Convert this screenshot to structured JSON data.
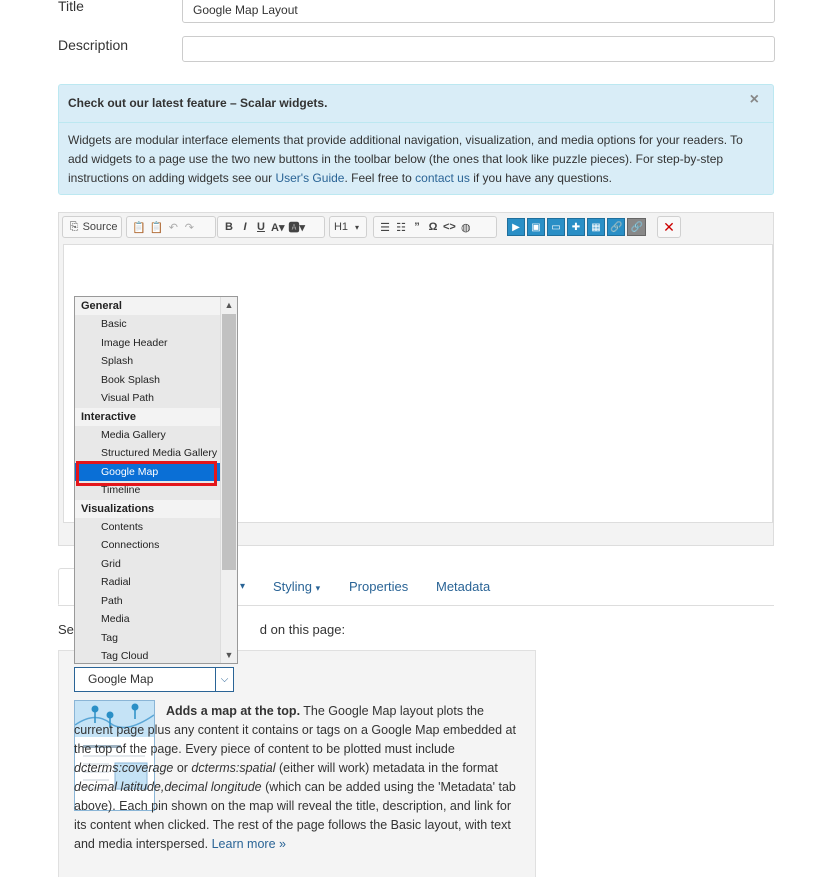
{
  "form": {
    "title_label": "Title",
    "title_value": "Google Map Layout",
    "description_label": "Description",
    "description_value": ""
  },
  "alert": {
    "heading": "Check out our latest feature – Scalar widgets.",
    "close": "×",
    "body_1": "Widgets are modular interface elements that provide additional navigation, visualization, and media options for your readers. To add widgets to a page use the two new buttons in the toolbar below (the ones that look like puzzle pieces). For step-by-step instructions on adding widgets see our ",
    "guide_link": "User's Guide",
    "body_2": ". Feel free to ",
    "contact_link": "contact us",
    "body_3": " if you have any questions."
  },
  "toolbar": {
    "source": "Source",
    "bold": "B",
    "italic": "I",
    "underline": "U",
    "heading": "H1",
    "quote": "”",
    "omega": "Ω",
    "code": "<>",
    "remove": "✕"
  },
  "dropdown": {
    "groups": [
      {
        "label": "General",
        "items": [
          "Basic",
          "Image Header",
          "Splash",
          "Book Splash",
          "Visual Path"
        ]
      },
      {
        "label": "Interactive",
        "items": [
          "Media Gallery",
          "Structured Media Gallery",
          "Google Map",
          "Timeline"
        ]
      },
      {
        "label": "Visualizations",
        "items": [
          "Contents",
          "Connections",
          "Grid",
          "Radial",
          "Path",
          "Media",
          "Tag",
          "Tag Cloud"
        ]
      }
    ],
    "selected": "Google Map"
  },
  "tabs": {
    "styling": "Styling",
    "properties": "Properties",
    "metadata": "Metadata"
  },
  "layout": {
    "select_prefix": "Sel",
    "select_suffix": "d on this page:",
    "selected_value": "Google Map",
    "desc_bold": "Adds a map at the top.",
    "desc_1": " The Google Map layout plots the current page plus any content it contains or tags on a Google Map embedded at the top of the page. Every piece of content to be plotted must include ",
    "desc_em1": "dcterms:coverage",
    "desc_2": " or ",
    "desc_em2": "dcterms:spatial",
    "desc_3": " (either will work) metadata in the format ",
    "desc_em3": "decimal latitude,decimal longitude",
    "desc_4": " (which can be added using the 'Metadata' tab above). Each pin shown on the map will reveal the title, description, and link for its content when clicked. The rest of the page follows the Basic layout, with text and media interspersed. ",
    "learn_more": "Learn more »"
  },
  "colors": {
    "accent": "#2a6496",
    "toolbar_blue": "#2a8fc6",
    "highlight_red": "#e3161b",
    "selected_blue": "#0a6fd6"
  }
}
